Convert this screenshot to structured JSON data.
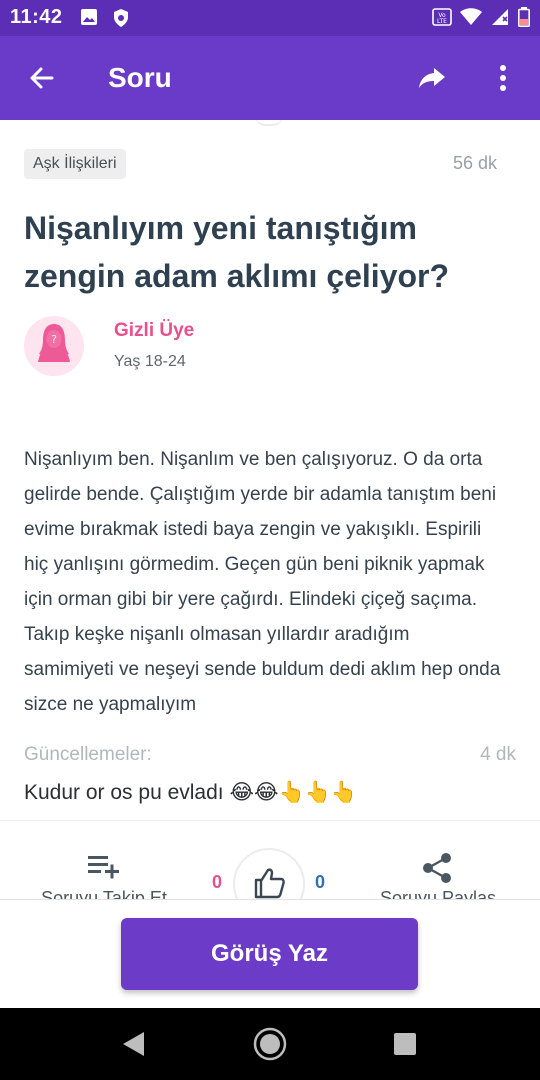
{
  "status_bar": {
    "time": "11:42",
    "icons": [
      "image-icon",
      "shield-icon",
      "volte-icon",
      "wifi-icon",
      "signal-icon",
      "battery-icon"
    ]
  },
  "app_bar": {
    "title": "Soru",
    "background": "#6a3ac8"
  },
  "question": {
    "category": "Aşk İlişkileri",
    "time_ago": "56 dk",
    "title": "Nişanlıyım yeni tanıştığım zengin adam aklımı çeliyor?",
    "author": {
      "name": "Gizli Üye",
      "age": "Yaş 18-24",
      "avatar_icon": "anonymous-female-avatar-icon",
      "name_color": "#e94f8d"
    },
    "body": "Nişanlıyım ben. Nişanlım ve ben çalışıyoruz. O da orta gelirde bende. Çalıştığım yerde bir adamla tanıştım beni evime bırakmak istedi baya zengin ve yakışıklı. Espirili hiç yanlışını görmedim. Geçen gün beni piknik yapmak için orman gibi bir yere çağırdı. Elindeki çiçeğ saçıma. Takıp keşke nişanlı olmasan yıllardır aradığım samimiyeti ve neşeyi sende buldum dedi aklım hep onda sizce ne yapmalıyım"
  },
  "updates": {
    "label": "Güncellemeler:",
    "time": "4 dk",
    "text": "Kudur or os pu evladı 😂😂👆👆👆"
  },
  "actions": {
    "follow_label": "Soruyu Takip Et",
    "share_label": "Soruyu Paylaş",
    "vote_down": "0",
    "vote_up": "0",
    "vote_down_color": "#e94f8d",
    "vote_up_color": "#2f6fb2"
  },
  "write_button": {
    "label": "Görüş Yaz",
    "color": "#6c3cc8"
  }
}
